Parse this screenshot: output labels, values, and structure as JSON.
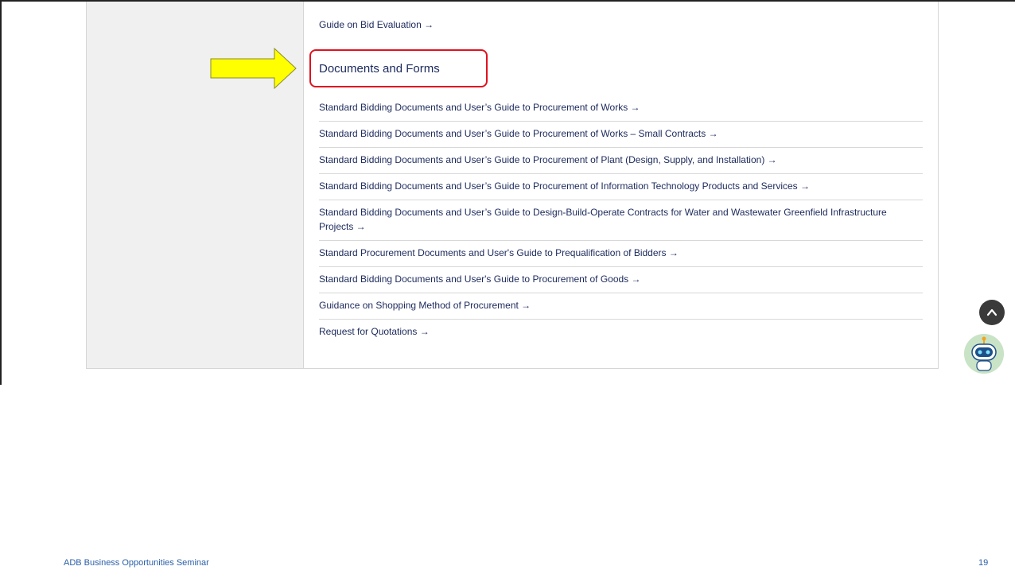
{
  "content": {
    "top_link": "Guide on Bid Evaluation →",
    "section_heading": "Documents and Forms",
    "links": [
      "Standard Bidding Documents and User’s Guide to Procurement of Works →",
      "Standard Bidding Documents and User’s Guide to Procurement of Works – Small Contracts →",
      "Standard Bidding Documents and User’s Guide to Procurement of Plant (Design, Supply, and Installation)  →",
      "Standard Bidding Documents and User’s Guide to Procurement of Information Technology Products and Services →",
      "Standard Bidding Documents and User’s Guide to Design-Build-Operate Contracts for Water and Wastewater Greenfield Infrastructure Projects →",
      "Standard Procurement Documents and User's Guide to Prequalification of Bidders →",
      "Standard Bidding Documents and User's Guide to Procurement of Goods →",
      "Guidance on Shopping Method of Procurement →",
      "Request for Quotations →"
    ]
  },
  "annotation": {
    "arrow_color": "#ffff00",
    "box_color": "#e0121f"
  },
  "widgets": {
    "scroll_top_icon": "chevron-up-icon",
    "chatbot_icon": "robot-icon"
  },
  "footer": {
    "left": "ADB Business Opportunities Seminar",
    "page_number": "19"
  }
}
